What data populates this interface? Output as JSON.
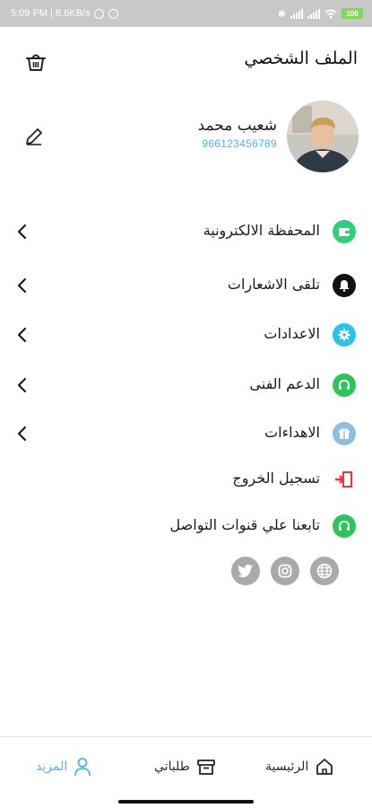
{
  "status_bar": {
    "time_speed": "5:09 PM | 8.6KB/s",
    "battery": "100",
    "colors": {
      "background": "#c8c8c8",
      "battery": "#7ed957"
    }
  },
  "header": {
    "title": "الملف الشخصي",
    "trash_icon": "basket-icon"
  },
  "profile": {
    "name": "شعيب محمد",
    "phone": "966123456789",
    "edit_icon": "pencil-icon"
  },
  "menu": [
    {
      "label": "المحفظة الالكترونية",
      "icon": "wallet-icon",
      "color": "#2ecf7d",
      "chevron": true
    },
    {
      "label": "تلقى الاشعارات",
      "icon": "bell-icon",
      "color": "#111111",
      "chevron": true
    },
    {
      "label": "الاعدادات",
      "icon": "gear-icon",
      "color": "#29c4e8",
      "chevron": true
    },
    {
      "label": "الدعم الفنى",
      "icon": "headset-icon",
      "color": "#2ec45a",
      "chevron": true
    },
    {
      "label": "الاهداءات",
      "icon": "gift-icon",
      "color": "#8fbfe0",
      "chevron": true
    },
    {
      "label": "تسجيل الخروج",
      "icon": "logout-icon",
      "color": "#e53935",
      "chevron": false
    },
    {
      "label": "تابعنا علي قنوات التواصل",
      "icon": "headset-icon",
      "color": "#2ec45a",
      "chevron": false
    }
  ],
  "social": [
    {
      "name": "twitter-icon"
    },
    {
      "name": "instagram-icon"
    },
    {
      "name": "globe-icon"
    }
  ],
  "bottom_nav": {
    "home": "الرئيسية",
    "orders": "طلباتي",
    "more": "المزيد",
    "active": "more",
    "accent": "#4fb3e8"
  }
}
